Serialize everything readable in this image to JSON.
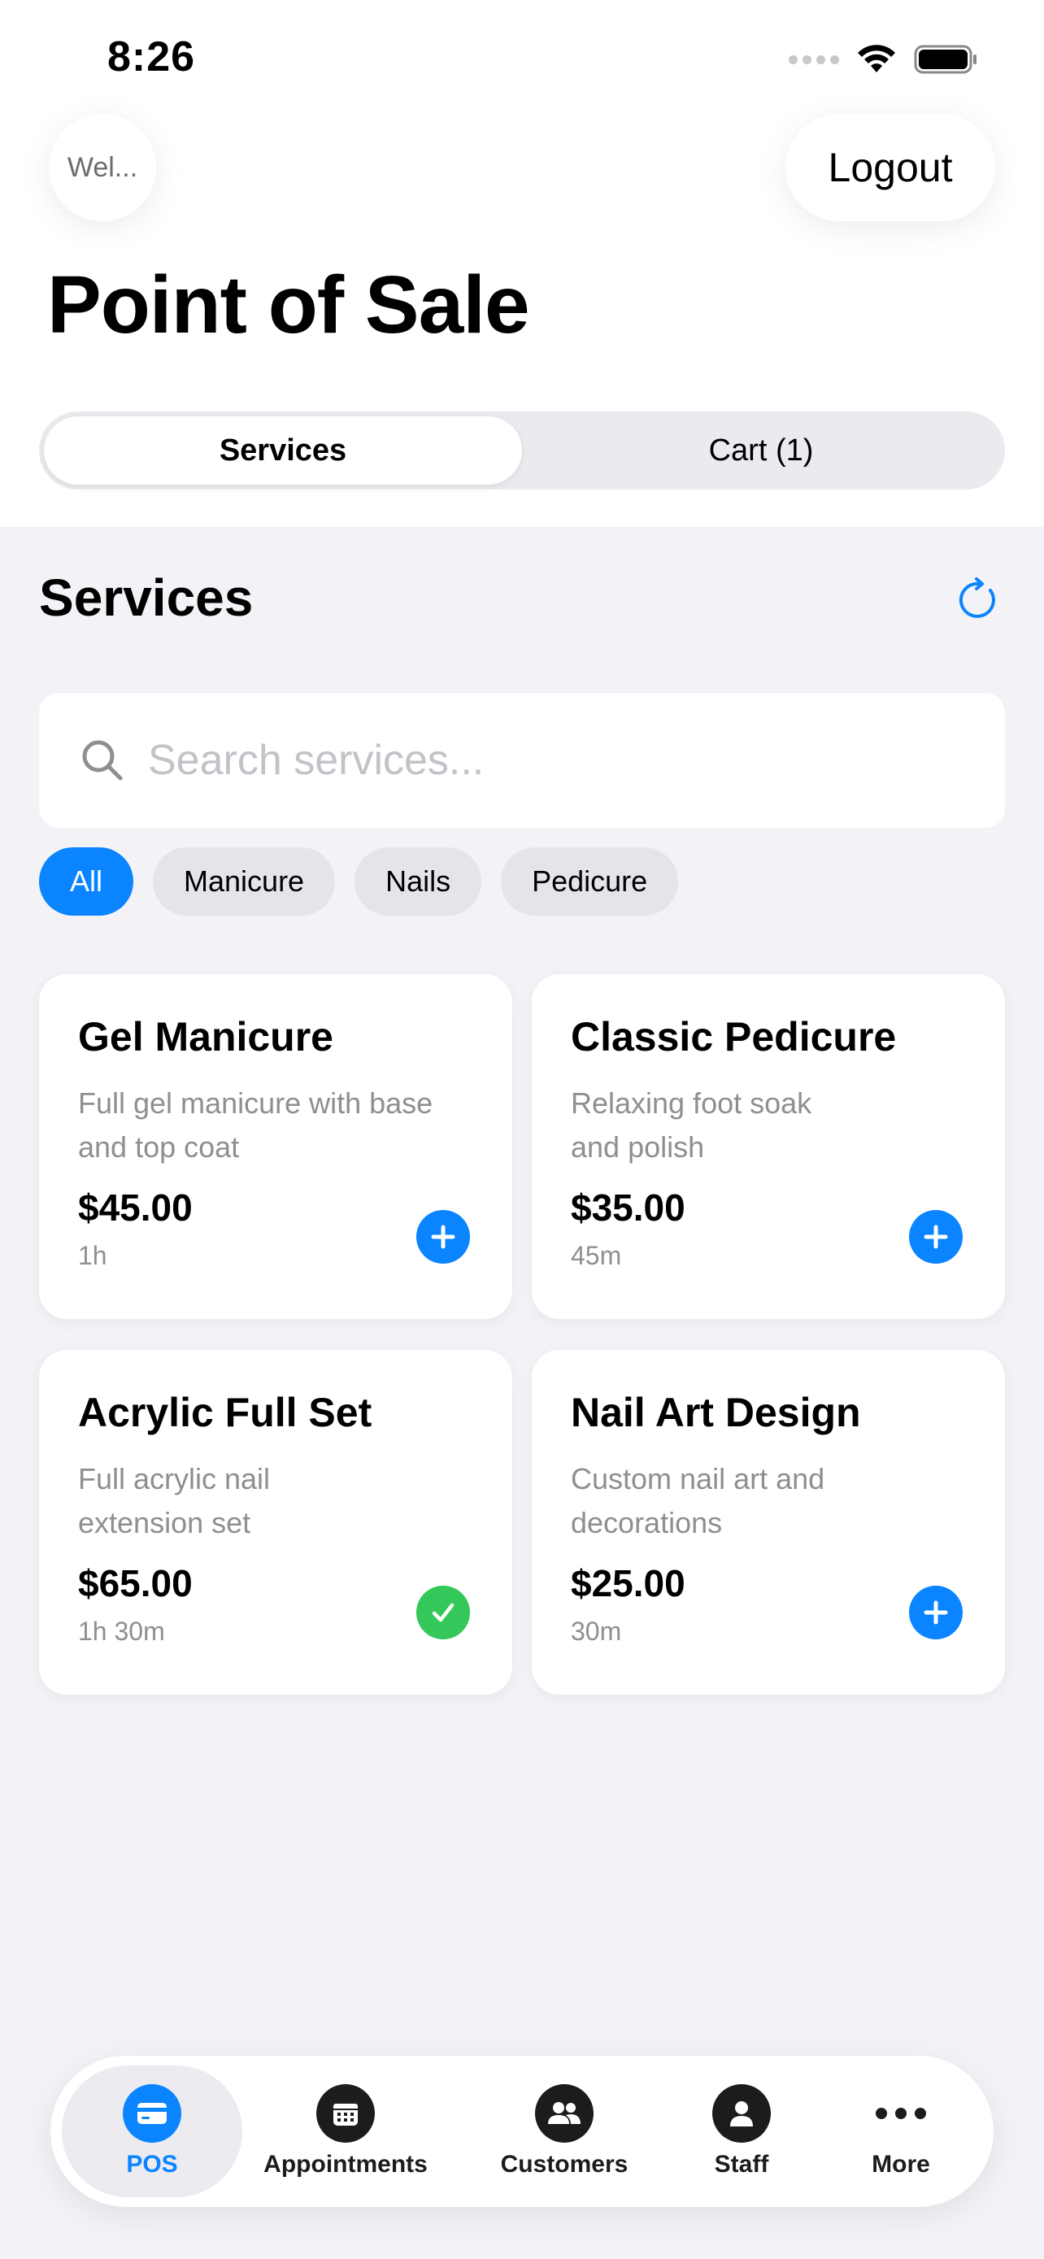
{
  "status_bar": {
    "time": "8:26"
  },
  "header": {
    "welcome_label": "Wel...",
    "logout_label": "Logout",
    "title": "Point of Sale"
  },
  "segments": [
    {
      "label": "Services",
      "active": true
    },
    {
      "label": "Cart (1)",
      "active": false
    }
  ],
  "section": {
    "title": "Services"
  },
  "search": {
    "placeholder": "Search services...",
    "value": ""
  },
  "filters": [
    {
      "label": "All",
      "active": true
    },
    {
      "label": "Manicure",
      "active": false
    },
    {
      "label": "Nails",
      "active": false
    },
    {
      "label": "Pedicure",
      "active": false
    }
  ],
  "services": [
    {
      "title": "Gel Manicure",
      "description": "Full gel manicure with base and top coat",
      "price": "$45.00",
      "duration": "1h",
      "in_cart": false
    },
    {
      "title": "Classic Pedicure",
      "description": "Relaxing foot soak and polish",
      "price": "$35.00",
      "duration": "45m",
      "in_cart": false
    },
    {
      "title": "Acrylic Full Set",
      "description": "Full acrylic nail extension set",
      "price": "$65.00",
      "duration": "1h 30m",
      "in_cart": true
    },
    {
      "title": "Nail Art Design",
      "description": "Custom nail art and decorations",
      "price": "$25.00",
      "duration": "30m",
      "in_cart": false
    }
  ],
  "tabbar": {
    "items": [
      {
        "label": "POS",
        "icon": "card-icon",
        "active": true
      },
      {
        "label": "Appointments",
        "icon": "calendar-icon",
        "active": false
      },
      {
        "label": "Customers",
        "icon": "people-icon",
        "active": false
      },
      {
        "label": "Staff",
        "icon": "person-icon",
        "active": false
      },
      {
        "label": "More",
        "icon": "ellipsis-icon",
        "active": false
      }
    ]
  },
  "colors": {
    "accent": "#0a84ff",
    "success": "#34c759",
    "background": "#f2f2f7"
  }
}
